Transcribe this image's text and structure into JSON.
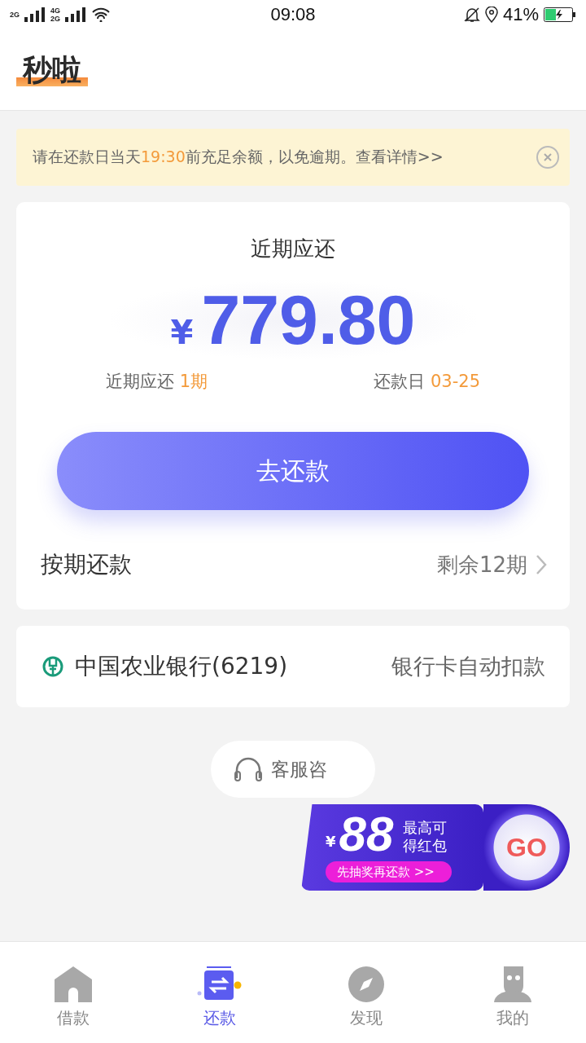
{
  "status_bar": {
    "networks": [
      "2G",
      "4G",
      "2G"
    ],
    "time": "09:08",
    "battery": "41%"
  },
  "header": {
    "title": "秒啦"
  },
  "notice": {
    "parts": [
      {
        "text": "请在还款日当天",
        "highlight": false
      },
      {
        "text": "19:30",
        "highlight": true
      },
      {
        "text": "前充足余额，以免逾期。查看详情>>",
        "highlight": false
      }
    ]
  },
  "repayment": {
    "title": "近期应还",
    "currency": "¥",
    "amount": "779.80",
    "summary": [
      {
        "label": "近期应还",
        "value": "1期"
      },
      {
        "label": "还款日",
        "value": "03-25"
      }
    ],
    "button": "去还款",
    "plan": {
      "label": "按期还款",
      "value": "剩余12期"
    }
  },
  "bank": {
    "name": "中国农业银行(6219)",
    "method": "银行卡自动扣款"
  },
  "support": {
    "label": "客服咨"
  },
  "promo": {
    "currency": "¥",
    "amount": "88",
    "lines": [
      "最高可",
      "得红包"
    ],
    "action": "先抽奖再还款",
    "arrows": ">>",
    "go": "GO"
  },
  "tabs": [
    {
      "label": "借款",
      "selected": false,
      "kind": "home"
    },
    {
      "label": "还款",
      "selected": true,
      "kind": "repay"
    },
    {
      "label": "发现",
      "selected": false,
      "kind": "discover"
    },
    {
      "label": "我的",
      "selected": false,
      "kind": "profile"
    }
  ]
}
